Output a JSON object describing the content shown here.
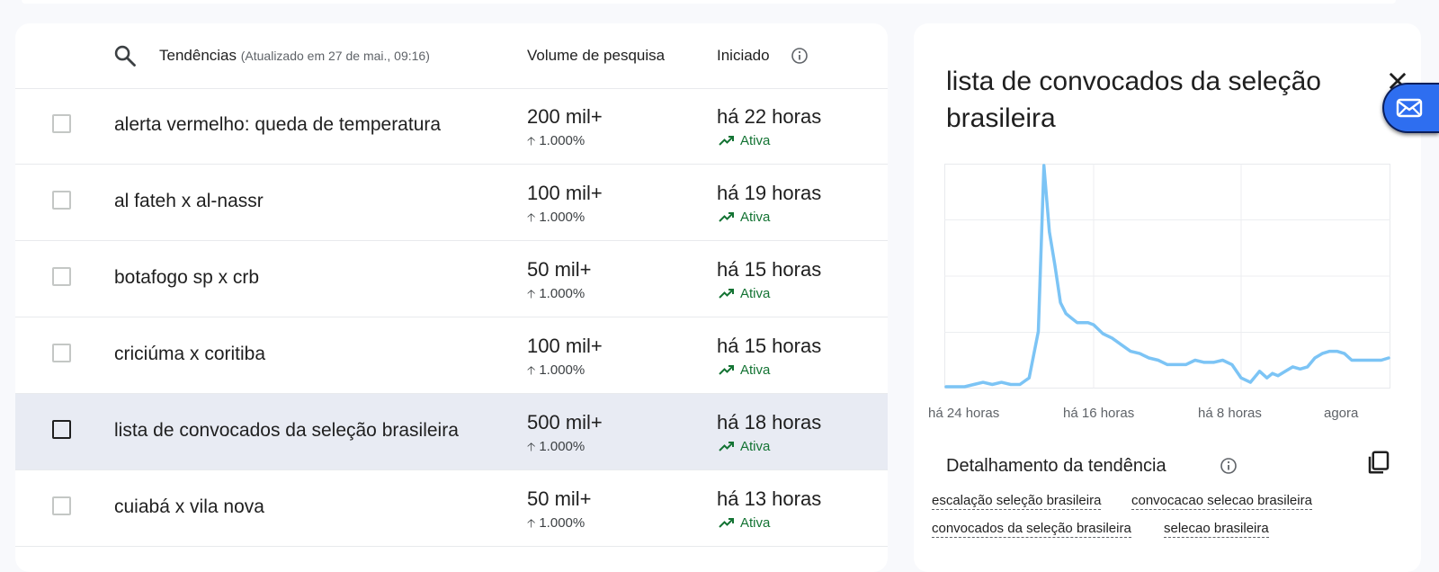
{
  "table": {
    "header": {
      "trends_label": "Tendências",
      "updated": "(Atualizado em 27 de mai., 09:16)",
      "volume_label": "Volume de pesquisa",
      "started_label": "Iniciado"
    },
    "rows": [
      {
        "name": "alerta vermelho: queda de temperatura",
        "volume": "200 mil+",
        "change": "1.000%",
        "started": "há 22 horas",
        "status": "Ativa"
      },
      {
        "name": "al fateh x al-nassr",
        "volume": "100 mil+",
        "change": "1.000%",
        "started": "há 19 horas",
        "status": "Ativa"
      },
      {
        "name": "botafogo sp x crb",
        "volume": "50 mil+",
        "change": "1.000%",
        "started": "há 15 horas",
        "status": "Ativa"
      },
      {
        "name": "criciúma x coritiba",
        "volume": "100 mil+",
        "change": "1.000%",
        "started": "há 15 horas",
        "status": "Ativa"
      },
      {
        "name": "lista de convocados da seleção brasileira",
        "volume": "500 mil+",
        "change": "1.000%",
        "started": "há 18 horas",
        "status": "Ativa",
        "selected": true
      },
      {
        "name": "cuiabá x vila nova",
        "volume": "50 mil+",
        "change": "1.000%",
        "started": "há 13 horas",
        "status": "Ativa"
      }
    ]
  },
  "panel": {
    "title": "lista de convocados da seleção brasileira",
    "breakdown_title": "Detalhamento da tendência",
    "chips": [
      "escalação seleção brasileira",
      "convocacao selecao brasileira",
      "convocados da seleção brasileira",
      "selecao brasileira"
    ]
  },
  "chart_data": {
    "type": "line",
    "x_tick_labels": [
      "há 24 horas",
      "há 16 horas",
      "há 8 horas",
      "agora"
    ],
    "x": [
      24,
      23.5,
      23,
      22.5,
      22,
      21.5,
      21,
      20.5,
      20,
      19.5,
      19,
      18.7,
      18.4,
      18.1,
      17.8,
      17.5,
      17.2,
      16.9,
      16.6,
      16.3,
      16,
      15.5,
      15,
      14.5,
      14,
      13.5,
      13,
      12.5,
      12,
      11.5,
      11,
      10.5,
      10,
      9.5,
      9,
      8.5,
      8,
      7.5,
      7,
      6.6,
      6.3,
      6,
      5.6,
      5.2,
      4.8,
      4.4,
      4,
      3.6,
      3.2,
      2.8,
      2.4,
      2,
      1.6,
      1.2,
      0.8,
      0.4,
      0
    ],
    "values": [
      0,
      0,
      0,
      1,
      2,
      1,
      2,
      1,
      1,
      4,
      25,
      100,
      70,
      55,
      38,
      33,
      31,
      29,
      29,
      29,
      28,
      24,
      22,
      19,
      16,
      15,
      13,
      12,
      10,
      10,
      10,
      12,
      11,
      11,
      12,
      10,
      4,
      2,
      7,
      4,
      6,
      5,
      7,
      9,
      8,
      9,
      13,
      15,
      16,
      16,
      15,
      12,
      12,
      12,
      12,
      12,
      13
    ],
    "ylim": [
      0,
      100
    ],
    "grid": true,
    "color": "#7cc4f5"
  },
  "colors": {
    "active_green": "#137333",
    "selected_row": "#e8ebf3",
    "fab_blue": "#2e6ef0"
  }
}
